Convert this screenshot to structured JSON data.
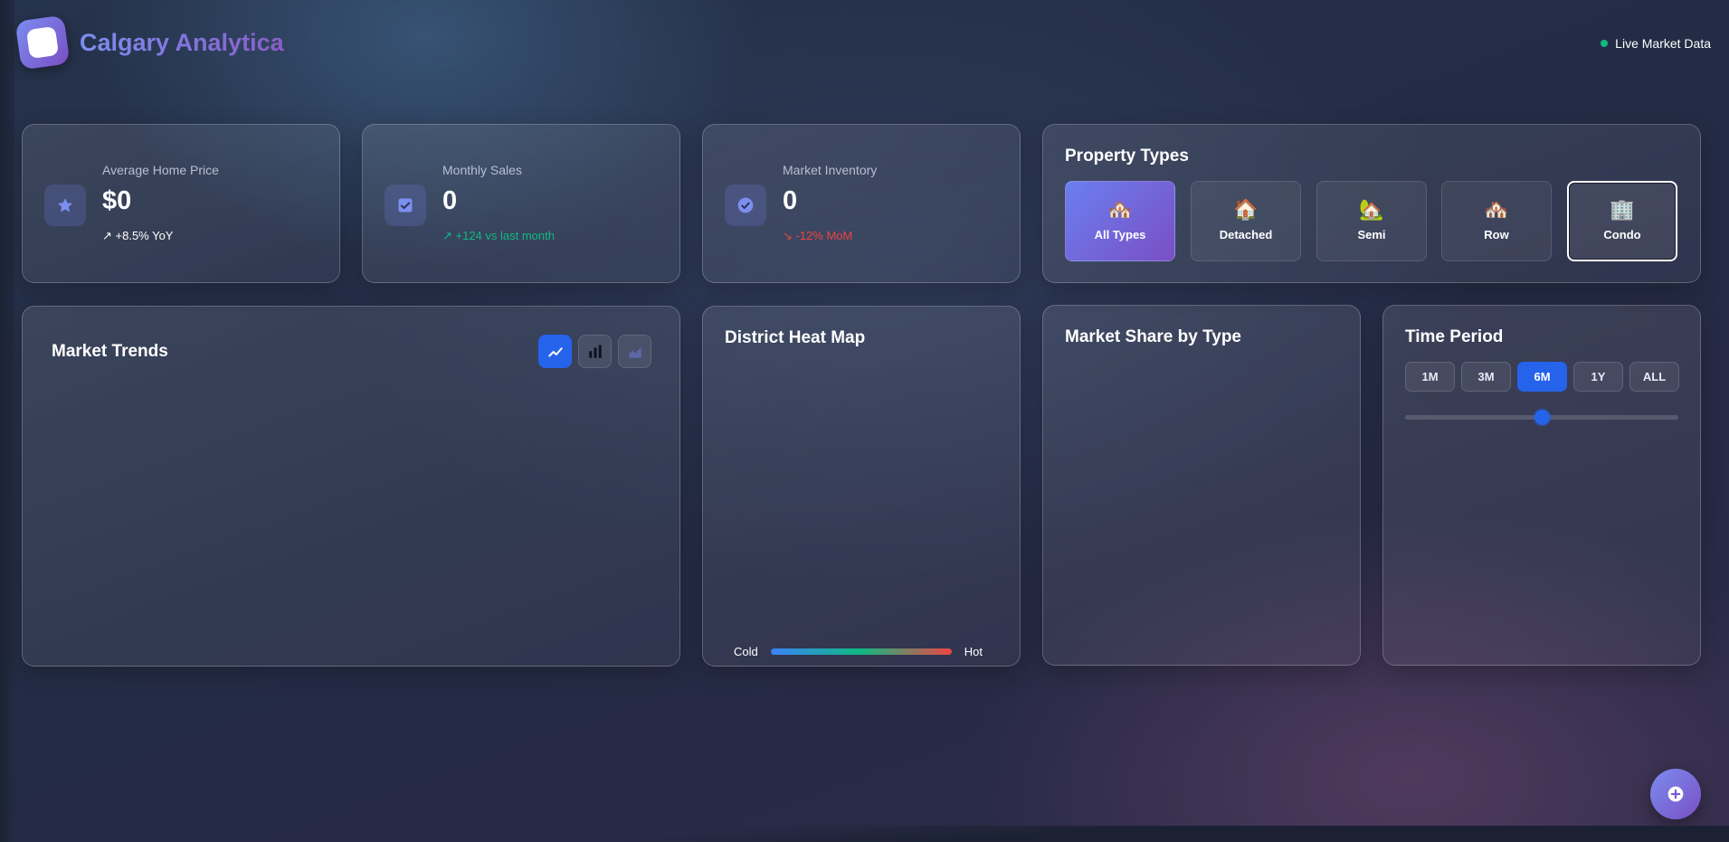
{
  "header": {
    "brand": "Calgary Analytica",
    "live_status": "Live Market Data"
  },
  "stats": [
    {
      "label": "Average Home Price",
      "value": "$0",
      "trend": "↗ +8.5% YoY",
      "icon": "star-icon"
    },
    {
      "label": "Monthly Sales",
      "value": "0",
      "trend": "↗ +124 vs last month",
      "icon": "checkbox-icon"
    },
    {
      "label": "Market Inventory",
      "value": "0",
      "trend": "↘ -12% MoM",
      "icon": "check-circle-icon"
    }
  ],
  "property_types": {
    "title": "Property Types",
    "items": [
      {
        "label": "All Types",
        "icon": "🏘️"
      },
      {
        "label": "Detached",
        "icon": "🏠"
      },
      {
        "label": "Semi",
        "icon": "🏡"
      },
      {
        "label": "Row",
        "icon": "🏘️"
      },
      {
        "label": "Condo",
        "icon": "🏢"
      }
    ],
    "active": "All Types"
  },
  "market_trends": {
    "title": "Market Trends",
    "chart_types": [
      "line-chart-icon",
      "bar-chart-icon",
      "area-chart-icon"
    ],
    "active_chart": "line-chart-icon"
  },
  "heat_map": {
    "title": "District Heat Map",
    "legend_cold": "Cold",
    "legend_hot": "Hot"
  },
  "market_share": {
    "title": "Market Share by Type"
  },
  "time_period": {
    "title": "Time Period",
    "options": [
      "1M",
      "3M",
      "6M",
      "1Y",
      "ALL"
    ],
    "active": "6M",
    "slider_fraction": 0.5
  },
  "colors": {
    "accent": "#2563eb",
    "brand_start": "#7c8ff0",
    "brand_end": "#8a5cc8",
    "up": "#10b981",
    "down": "#ef4444"
  }
}
